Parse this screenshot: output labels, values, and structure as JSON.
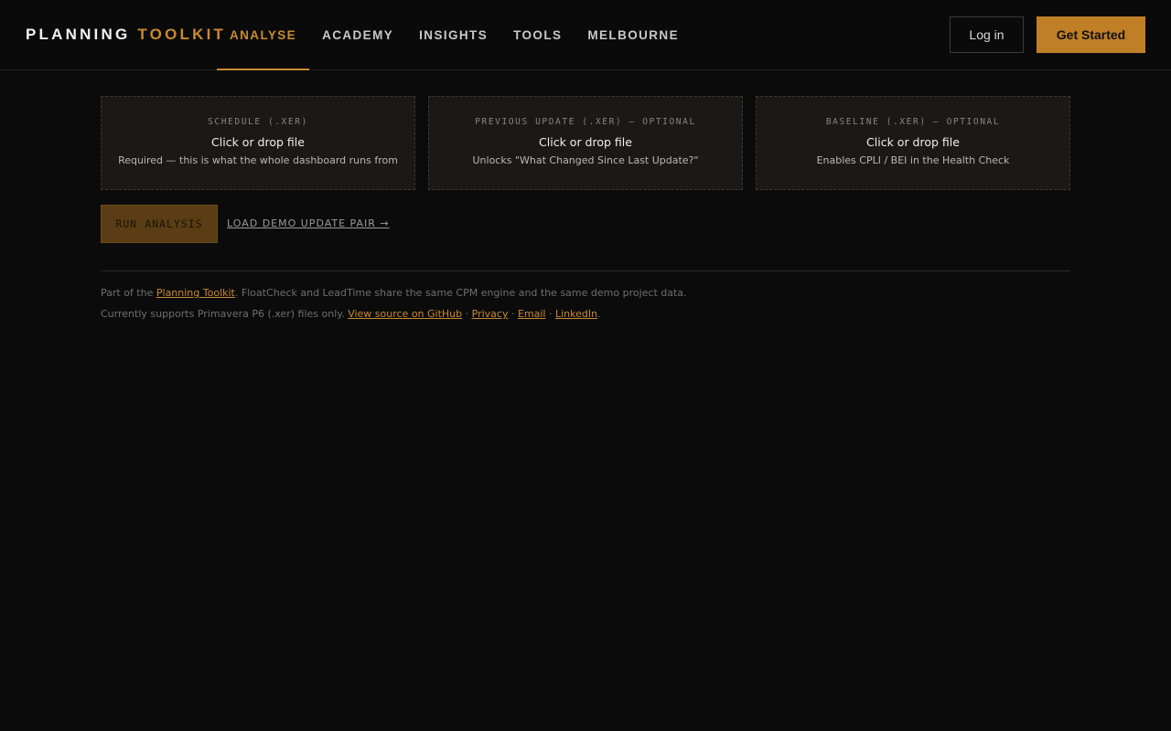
{
  "brand": {
    "part1": "PLANNING",
    "part2": "TOOLKIT"
  },
  "nav": {
    "items": [
      {
        "label": "ANALYSE",
        "active": true
      },
      {
        "label": "ACADEMY"
      },
      {
        "label": "INSIGHTS"
      },
      {
        "label": "TOOLS"
      },
      {
        "label": "MELBOURNE"
      }
    ]
  },
  "header": {
    "login_label": "Log in",
    "cta_label": "Get Started"
  },
  "uploads": [
    {
      "label": "SCHEDULE (.XER)",
      "action": "Click or drop file",
      "hint": "Required — this is what the whole dashboard runs from"
    },
    {
      "label": "PREVIOUS UPDATE (.XER) — OPTIONAL",
      "action": "Click or drop file",
      "hint": "Unlocks \"What Changed Since Last Update?\""
    },
    {
      "label": "BASELINE (.XER) — OPTIONAL",
      "action": "Click or drop file",
      "hint": "Enables CPLI / BEI in the Health Check"
    }
  ],
  "actions": {
    "run_label": "RUN ANALYSIS",
    "demo_label": "LOAD DEMO UPDATE PAIR →"
  },
  "footer": {
    "line1_prefix": "Part of the ",
    "line1_link": "Planning Toolkit",
    "line1_suffix": ". FloatCheck and LeadTime share the same CPM engine and the same demo project data.",
    "line2_prefix": "Currently supports Primavera P6 (.xer) files only. ",
    "links": [
      "View source on GitHub",
      "Privacy",
      "Email",
      "LinkedIn"
    ],
    "separator": " · ",
    "line2_suffix": "."
  },
  "colors": {
    "accent": "#c98a31",
    "background": "#0b0b0b",
    "card": "#1b1815"
  }
}
